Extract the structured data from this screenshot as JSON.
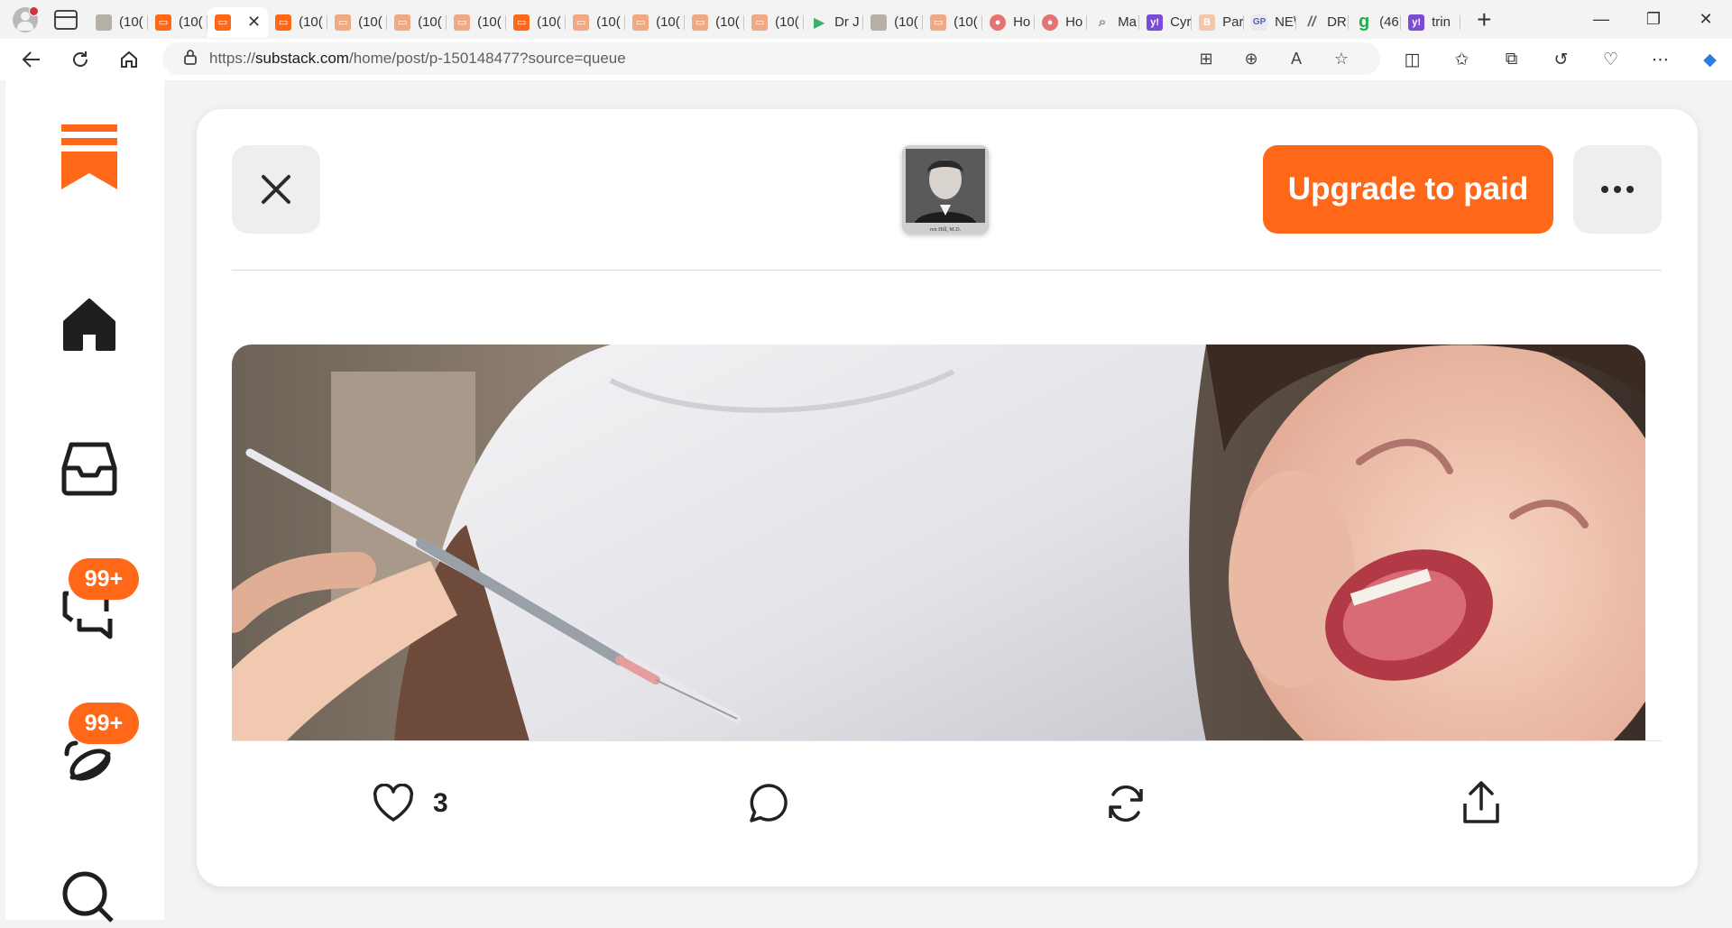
{
  "browser": {
    "tabs": [
      {
        "label": "(10(",
        "favicon": "photo"
      },
      {
        "label": "(10(",
        "favicon": "substack"
      },
      {
        "label": "",
        "favicon": "substack",
        "active": true
      },
      {
        "label": "(10(",
        "favicon": "substack"
      },
      {
        "label": "(10(",
        "favicon": "substack-faded"
      },
      {
        "label": "(10(",
        "favicon": "substack-faded"
      },
      {
        "label": "(10(",
        "favicon": "substack-faded"
      },
      {
        "label": "(10(",
        "favicon": "substack"
      },
      {
        "label": "(10(",
        "favicon": "substack-faded"
      },
      {
        "label": "(10(",
        "favicon": "substack-faded"
      },
      {
        "label": "(10(",
        "favicon": "substack-faded"
      },
      {
        "label": "(10(",
        "favicon": "substack-faded"
      },
      {
        "label": "Dr J",
        "favicon": "play"
      },
      {
        "label": "(10(",
        "favicon": "photo"
      },
      {
        "label": "(10(",
        "favicon": "substack-faded"
      },
      {
        "label": "Ho",
        "favicon": "podcast"
      },
      {
        "label": "Ho",
        "favicon": "podcast"
      },
      {
        "label": "Ma",
        "favicon": "search"
      },
      {
        "label": "Cyr",
        "favicon": "yahoo"
      },
      {
        "label": "Par",
        "favicon": "faded"
      },
      {
        "label": "NE\\",
        "favicon": "gp"
      },
      {
        "label": "DR",
        "favicon": "slash"
      },
      {
        "label": "(46",
        "favicon": "g"
      },
      {
        "label": "trin",
        "favicon": "yahoo"
      }
    ],
    "url_prefix": "https://",
    "url_domain": "substack.com",
    "url_path": "/home/post/p-150148477?source=queue"
  },
  "sidebar": {
    "badges": [
      "99+",
      "99+"
    ]
  },
  "post": {
    "upgrade_label": "Upgrade to paid",
    "like_count": "3",
    "avatar_caption": "ren Hill, M.D."
  },
  "colors": {
    "accent": "#ff6719",
    "card_bg": "#ffffff",
    "page_bg": "#f3f3f3"
  }
}
